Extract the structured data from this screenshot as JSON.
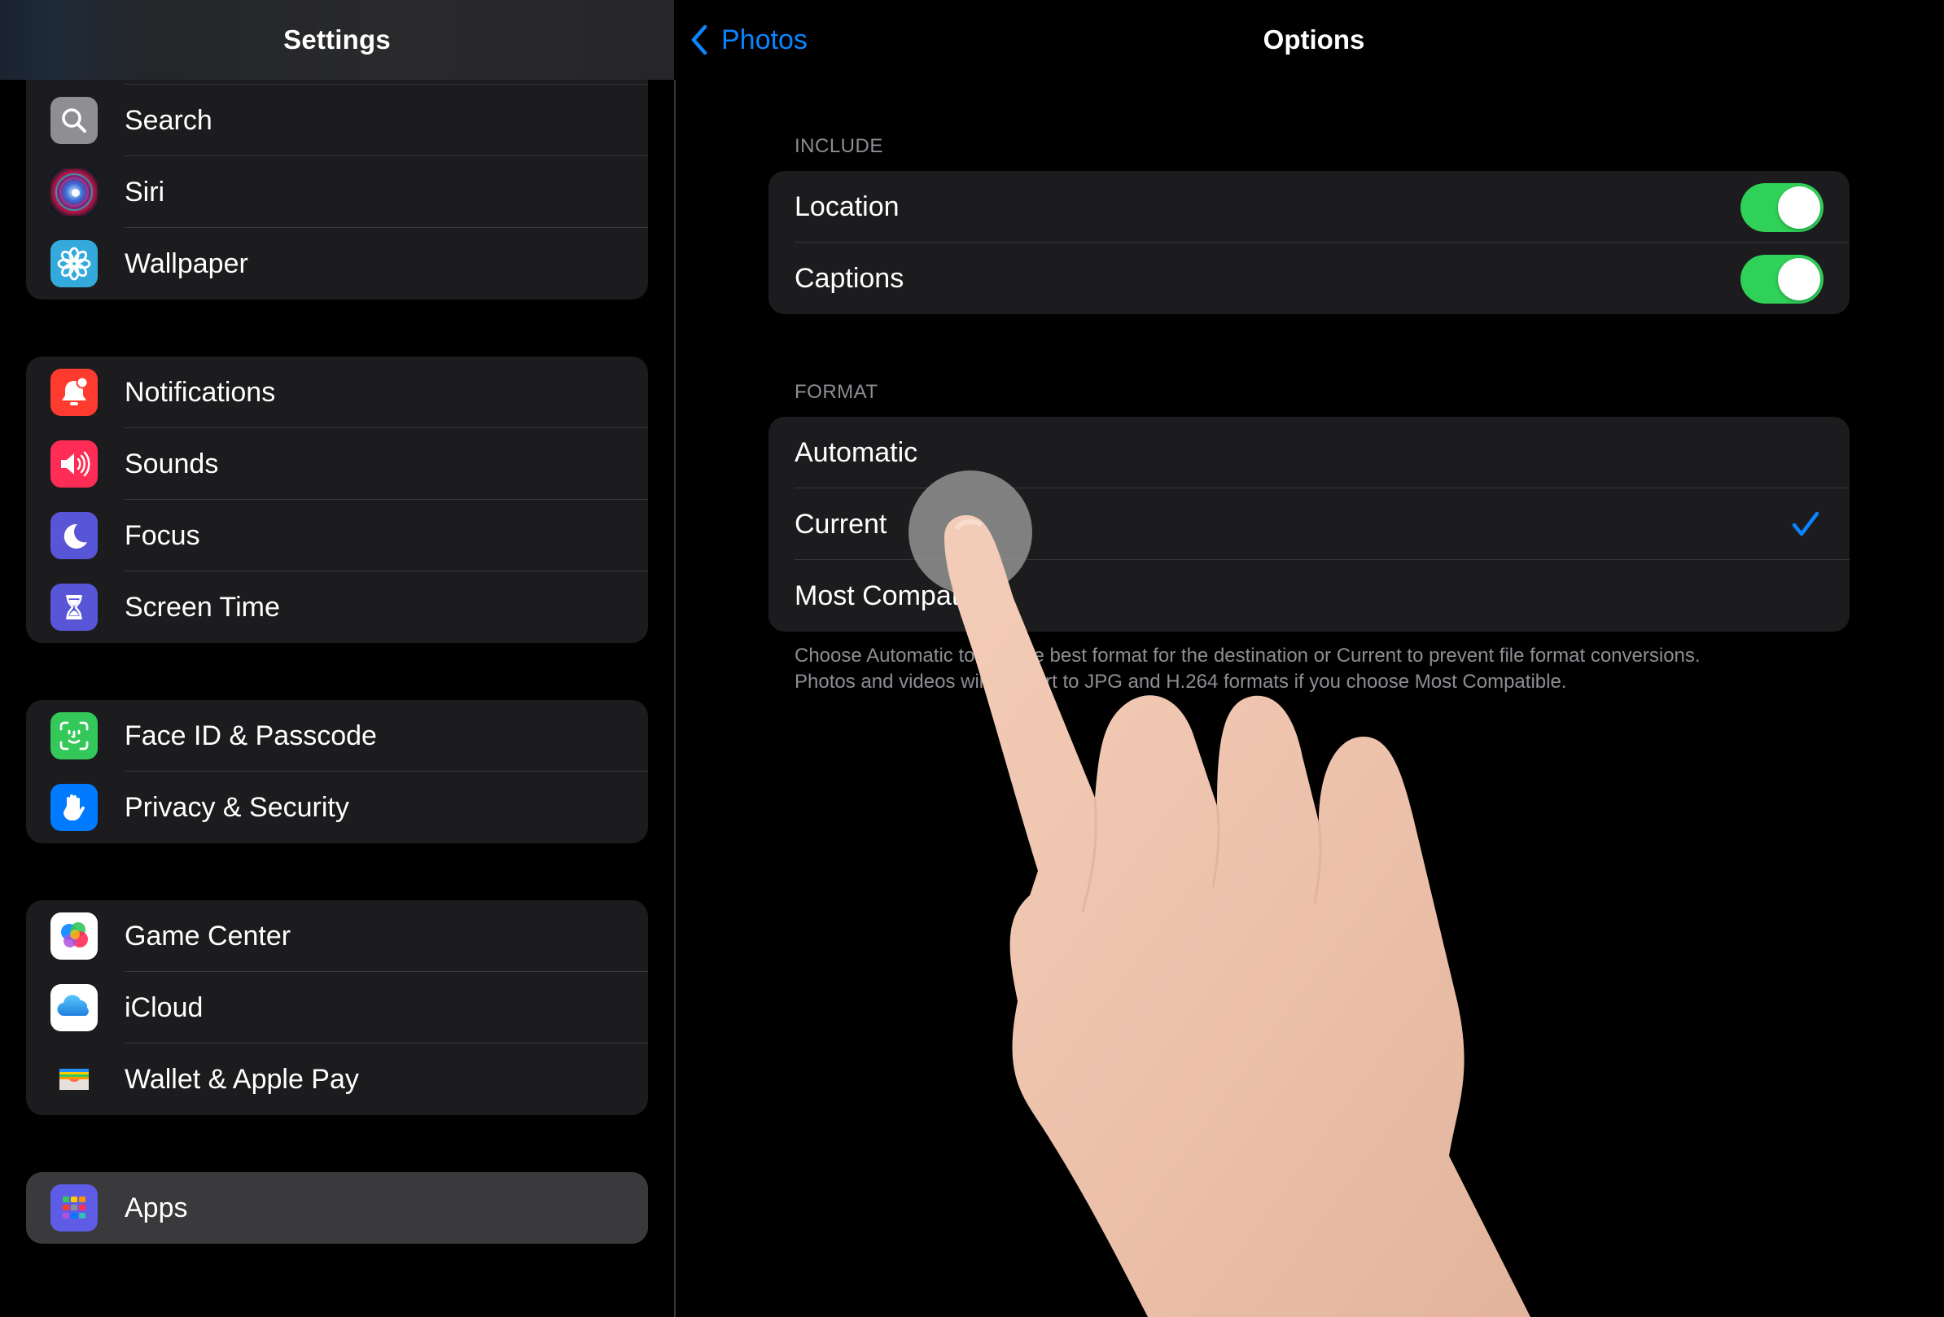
{
  "sidebar": {
    "title": "Settings",
    "groups": [
      {
        "items": [
          {
            "label": "Search",
            "icon": "search-icon",
            "color": "#8e8e93"
          },
          {
            "label": "Siri",
            "icon": "siri-icon",
            "color": "#1c1c2e"
          },
          {
            "label": "Wallpaper",
            "icon": "flower-icon",
            "color": "#34aadc"
          }
        ]
      },
      {
        "items": [
          {
            "label": "Notifications",
            "icon": "bell-badge-icon",
            "color": "#ff3b30"
          },
          {
            "label": "Sounds",
            "icon": "speaker-icon",
            "color": "#ff2d55"
          },
          {
            "label": "Focus",
            "icon": "moon-icon",
            "color": "#5856d6"
          },
          {
            "label": "Screen Time",
            "icon": "hourglass-icon",
            "color": "#5856d6"
          }
        ]
      },
      {
        "items": [
          {
            "label": "Face ID & Passcode",
            "icon": "face-id-icon",
            "color": "#34c759"
          },
          {
            "label": "Privacy & Security",
            "icon": "hand-icon",
            "color": "#007aff"
          }
        ]
      },
      {
        "items": [
          {
            "label": "Game Center",
            "icon": "game-center-icon",
            "color": "#ffffff"
          },
          {
            "label": "iCloud",
            "icon": "cloud-icon",
            "color": "#ffffff"
          },
          {
            "label": "Wallet & Apple Pay",
            "icon": "wallet-icon",
            "color": "#1c1c1e"
          }
        ]
      },
      {
        "items": [
          {
            "label": "Apps",
            "icon": "apps-grid-icon",
            "color": "#5e5ce6",
            "selected": true
          }
        ]
      }
    ]
  },
  "detail": {
    "back_label": "Photos",
    "title": "Options",
    "include": {
      "header": "INCLUDE",
      "rows": [
        {
          "label": "Location",
          "on": true
        },
        {
          "label": "Captions",
          "on": true
        }
      ]
    },
    "format": {
      "header": "FORMAT",
      "options": [
        {
          "label": "Automatic",
          "selected": false
        },
        {
          "label": "Current",
          "selected": true
        },
        {
          "label": "Most Compatible",
          "selected": false
        }
      ],
      "footer_line1": "Choose Automatic to use the best format for the destination or Current to prevent file format conversions.",
      "footer_line2": "Photos and videos will convert to JPG and H.264 formats if you choose Most Compatible."
    }
  },
  "colors": {
    "accent": "#0a84ff",
    "toggle_on": "#30d158",
    "cell_bg": "#1c1c1e",
    "selected_bg": "#3a3a3c",
    "secondary_text": "#8d8d93"
  }
}
